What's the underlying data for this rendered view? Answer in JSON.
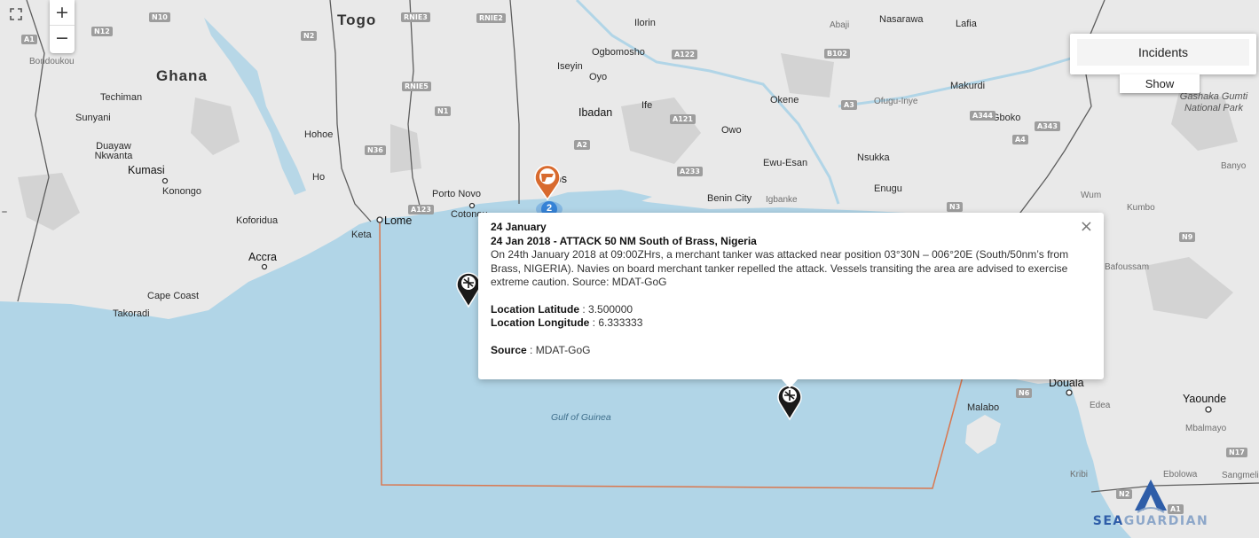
{
  "colors": {
    "land": "#e9e9e9",
    "water": "#b1d5e7",
    "border": "#5e5e5e",
    "zone_outline": "#d9774f",
    "cluster_marker": "#3582d6",
    "incident_marker": "#d86a2e"
  },
  "controls": {
    "fullscreen_icon": "fullscreen-icon",
    "zoom_in": "+",
    "zoom_out": "−"
  },
  "incidents_panel": {
    "title": "Incidents",
    "show_label": "Show"
  },
  "cluster": {
    "count": "2"
  },
  "popup": {
    "close": "×",
    "date": "24 January",
    "title": "24 Jan 2018 - ATTACK 50 NM South of Brass, Nigeria",
    "description": "On 24th January 2018 at 09:00ZHrs, a merchant tanker was attacked near position 03°30N – 006°20E (South/50nm’s from Brass, NIGERIA). Navies on board merchant tanker repelled the attack. Vessels transiting the area are advised to exercise extreme caution. Source: MDAT-GoG",
    "latitude_label": "Location Latitude",
    "latitude_value": "3.500000",
    "longitude_label": "Location Longitude",
    "longitude_value": "6.333333",
    "source_label": "Source",
    "source_value": "MDAT-GoG"
  },
  "logo": {
    "part1": "SEA",
    "part2": "GUARDIAN"
  },
  "map": {
    "countries": [
      "Togo",
      "Ghana"
    ],
    "cities": [
      "Kumasi",
      "Accra",
      "Cape Coast",
      "Takoradi",
      "Lome",
      "Porto Novo",
      "Cotonou",
      "Lagos",
      "Ibadan",
      "Ogbomosho",
      "Ilorin",
      "Makurdi",
      "Benin City",
      "Douala",
      "Yaounde",
      "Malabo",
      "Koforidua",
      "Techiman",
      "Sunyani",
      "Duayaw Nkwanta",
      "Konongo",
      "Ho",
      "Hohoe",
      "Keta",
      "Iseyin",
      "Oyo",
      "Ife",
      "Owo",
      "Okene",
      "Ewu-Esan",
      "Igbanke",
      "Nsukka",
      "Enugu",
      "Gboko",
      "Ofugu-Inye",
      "Nasarawa",
      "Lafia",
      "Abaji",
      "Bondoukou",
      "Wum",
      "Kumbo",
      "Banyo",
      "Bafoussam",
      "Edea",
      "Mbalmayo",
      "Ebolowa",
      "Kribi",
      "Sangmelima"
    ],
    "minor": [
      "Gashaka Gumti National Park",
      "Gulf of Guinea",
      "Ilorin"
    ],
    "roads": [
      "N10",
      "N12",
      "A1",
      "N2",
      "RNIE3",
      "RNIE2",
      "RNIE5",
      "N1",
      "N36",
      "A123",
      "A122",
      "A121",
      "A233",
      "A3",
      "A344",
      "A4",
      "A343",
      "N3",
      "N6",
      "N9",
      "N17",
      "N2",
      "A1",
      "A2",
      "B102"
    ]
  }
}
